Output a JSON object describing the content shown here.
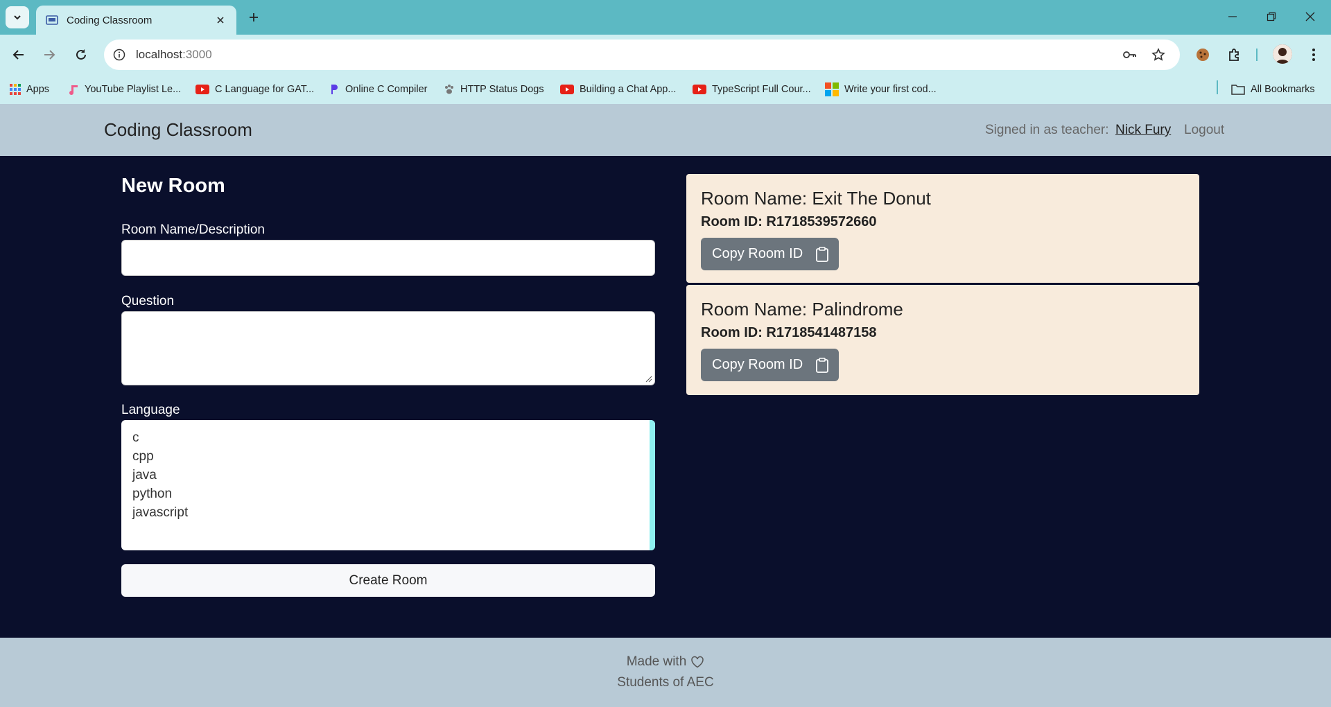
{
  "browser": {
    "tab_title": "Coding Classroom",
    "url_host": "localhost",
    "url_port": ":3000",
    "bookmarks": [
      {
        "label": "Apps",
        "icon": "apps-grid-icon"
      },
      {
        "label": "YouTube Playlist Le...",
        "icon": "music-note-icon"
      },
      {
        "label": "C Language for GAT...",
        "icon": "youtube-icon"
      },
      {
        "label": "Online C Compiler",
        "icon": "programiz-icon"
      },
      {
        "label": "HTTP Status Dogs",
        "icon": "paw-icon"
      },
      {
        "label": "Building a Chat App...",
        "icon": "youtube-icon"
      },
      {
        "label": "TypeScript Full Cour...",
        "icon": "youtube-icon"
      },
      {
        "label": "Write your first cod...",
        "icon": "microsoft-icon"
      }
    ],
    "all_bookmarks": "All Bookmarks"
  },
  "navbar": {
    "brand": "Coding Classroom",
    "signed_in_text": "Signed in as teacher:",
    "user_name": "Nick Fury",
    "logout": "Logout"
  },
  "form": {
    "title": "New Room",
    "room_name_label": "Room Name/Description",
    "room_name_value": "",
    "question_label": "Question",
    "question_value": "",
    "language_label": "Language",
    "languages": [
      "c",
      "cpp",
      "java",
      "python",
      "javascript"
    ],
    "create_button": "Create Room"
  },
  "rooms": [
    {
      "name": "Room Name: Exit The Donut",
      "id": "Room ID: R1718539572660",
      "copy_label": "Copy Room ID"
    },
    {
      "name": "Room Name: Palindrome",
      "id": "Room ID: R1718541487158",
      "copy_label": "Copy Room ID"
    }
  ],
  "footer": {
    "line1": "Made with",
    "line2": "Students of AEC"
  }
}
